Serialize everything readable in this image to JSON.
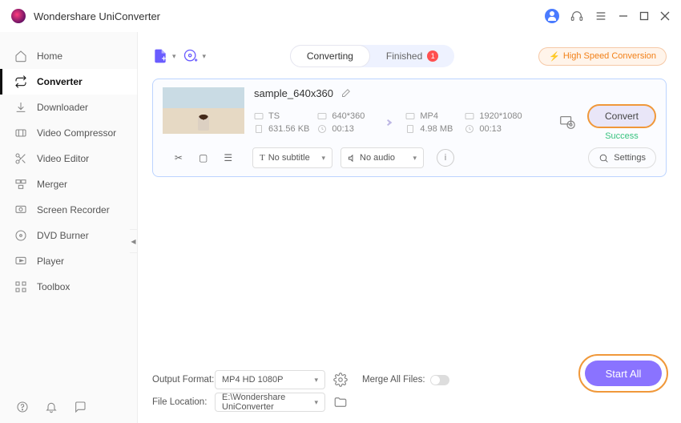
{
  "app": {
    "title": "Wondershare UniConverter"
  },
  "sidebar": {
    "items": [
      {
        "label": "Home"
      },
      {
        "label": "Converter"
      },
      {
        "label": "Downloader"
      },
      {
        "label": "Video Compressor"
      },
      {
        "label": "Video Editor"
      },
      {
        "label": "Merger"
      },
      {
        "label": "Screen Recorder"
      },
      {
        "label": "DVD Burner"
      },
      {
        "label": "Player"
      },
      {
        "label": "Toolbox"
      }
    ]
  },
  "tabs": {
    "converting": "Converting",
    "finished": "Finished",
    "finished_badge": "1"
  },
  "speed_label": "High Speed Conversion",
  "file": {
    "name": "sample_640x360",
    "src": {
      "format": "TS",
      "res": "640*360",
      "size": "631.56 KB",
      "dur": "00:13"
    },
    "dst": {
      "format": "MP4",
      "res": "1920*1080",
      "size": "4.98 MB",
      "dur": "00:13"
    },
    "convert_label": "Convert",
    "status": "Success",
    "subtitle_select": "No subtitle",
    "audio_select": "No audio",
    "settings_label": "Settings"
  },
  "footer": {
    "output_format_label": "Output Format:",
    "output_format_value": "MP4 HD 1080P",
    "file_location_label": "File Location:",
    "file_location_value": "E:\\Wondershare UniConverter",
    "merge_label": "Merge All Files:",
    "start_all": "Start All"
  }
}
